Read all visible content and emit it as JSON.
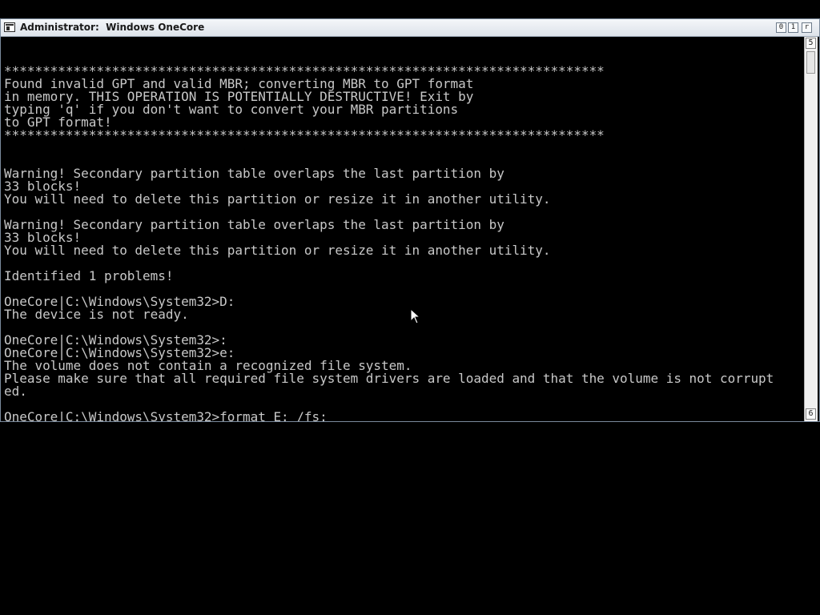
{
  "window": {
    "title": "Administrator:  Windows OneCore",
    "controls": {
      "minimize_glyph": "0",
      "maximize_glyph": "1",
      "close_glyph": "r"
    },
    "scrollbar": {
      "up_glyph": "5",
      "down_glyph": "6"
    }
  },
  "console": {
    "lines": [
      "",
      "",
      "******************************************************************************",
      "Found invalid GPT and valid MBR; converting MBR to GPT format",
      "in memory. THIS OPERATION IS POTENTIALLY DESTRUCTIVE! Exit by",
      "typing 'q' if you don't want to convert your MBR partitions",
      "to GPT format!",
      "******************************************************************************",
      "",
      "",
      "Warning! Secondary partition table overlaps the last partition by",
      "33 blocks!",
      "You will need to delete this partition or resize it in another utility.",
      "",
      "Warning! Secondary partition table overlaps the last partition by",
      "33 blocks!",
      "You will need to delete this partition or resize it in another utility.",
      "",
      "Identified 1 problems!",
      "",
      "OneCore|C:\\Windows\\System32>D:",
      "The device is not ready.",
      "",
      "OneCore|C:\\Windows\\System32>:",
      "OneCore|C:\\Windows\\System32>e:",
      "The volume does not contain a recognized file system.",
      "Please make sure that all required file system drivers are loaded and that the volume is not corrupt",
      "ed.",
      "",
      "OneCore|C:\\Windows\\System32>format E: /fs:"
    ]
  }
}
